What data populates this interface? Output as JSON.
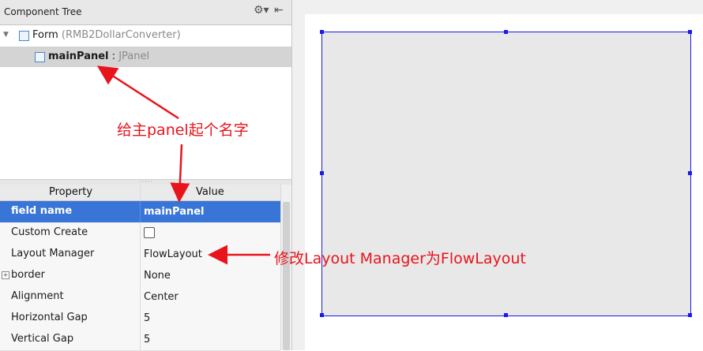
{
  "component_tree": {
    "title": "Component Tree",
    "icons": [
      "gear-icon",
      "collapse-icon"
    ],
    "nodes": [
      {
        "name": "Form",
        "detail": "(RMB2DollarConverter)"
      },
      {
        "name": "mainPanel",
        "separator": ":",
        "type": "JPanel"
      }
    ]
  },
  "property_table": {
    "headers": {
      "property": "Property",
      "value": "Value"
    },
    "rows": [
      {
        "name": "field name",
        "value": "mainPanel",
        "selected": true
      },
      {
        "name": "Custom Create",
        "value": "",
        "checkbox": true
      },
      {
        "name": "Layout Manager",
        "value": "FlowLayout"
      },
      {
        "name": "border",
        "value": "None",
        "expandable": true,
        "expander": "+"
      },
      {
        "name": "Alignment",
        "value": "Center"
      },
      {
        "name": "Horizontal Gap",
        "value": "5"
      },
      {
        "name": "Vertical Gap",
        "value": "5"
      }
    ]
  },
  "annotations": {
    "name_panel": "给主panel起个名字",
    "layout_manager": "修改Layout Manager为FlowLayout",
    "color": "#e8141c"
  },
  "colors": {
    "selection": "#3875d7",
    "panel_border": "#1a1af0",
    "panel_fill": "#e8e8e8"
  }
}
